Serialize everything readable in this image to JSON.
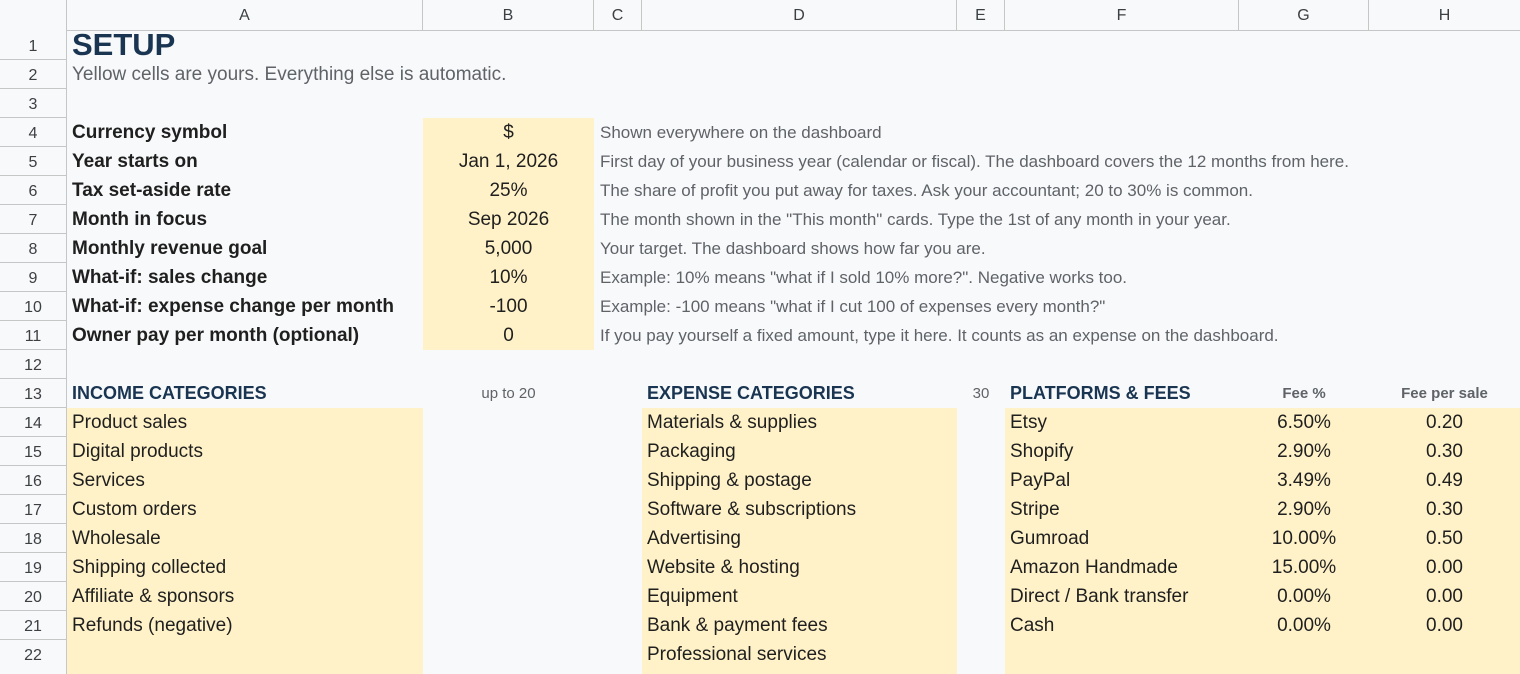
{
  "columns": [
    "A",
    "B",
    "C",
    "D",
    "E",
    "F",
    "G",
    "H"
  ],
  "rows": [
    "1",
    "2",
    "3",
    "4",
    "5",
    "6",
    "7",
    "8",
    "9",
    "10",
    "11",
    "12",
    "13",
    "14",
    "15",
    "16",
    "17",
    "18",
    "19",
    "20",
    "21",
    "22"
  ],
  "title": "SETUP",
  "subtitle": "Yellow cells are yours. Everything else is automatic.",
  "settings": [
    {
      "label": "Currency symbol",
      "value": "$",
      "desc": "Shown everywhere on the dashboard"
    },
    {
      "label": "Year starts on",
      "value": "Jan 1, 2026",
      "desc": "First day of your business year (calendar or fiscal). The dashboard covers the 12 months from here."
    },
    {
      "label": "Tax set-aside rate",
      "value": "25%",
      "desc": "The share of profit you put away for taxes. Ask your accountant; 20 to 30% is common."
    },
    {
      "label": "Month in focus",
      "value": "Sep 2026",
      "desc": "The month shown in the \"This month\" cards. Type the 1st of any month in your year."
    },
    {
      "label": "Monthly revenue goal",
      "value": "5,000",
      "desc": "Your target. The dashboard shows how far you are."
    },
    {
      "label": "What-if: sales change",
      "value": "10%",
      "desc": "Example: 10% means \"what if I sold 10% more?\". Negative works too."
    },
    {
      "label": "What-if: expense change per month",
      "value": "-100",
      "desc": "Example: -100 means \"what if I cut 100 of expenses every month?\""
    },
    {
      "label": "Owner pay per month (optional)",
      "value": "0",
      "desc": "If you pay yourself a fixed amount, type it here. It counts as an expense on the dashboard."
    }
  ],
  "income": {
    "heading": "INCOME CATEGORIES",
    "note": "up to 20",
    "items": [
      "Product sales",
      "Digital products",
      "Services",
      "Custom orders",
      "Wholesale",
      "Shipping collected",
      "Affiliate & sponsors",
      "Refunds (negative)",
      ""
    ]
  },
  "expense": {
    "heading": "EXPENSE CATEGORIES",
    "note": "30",
    "items": [
      "Materials & supplies",
      "Packaging",
      "Shipping & postage",
      "Software & subscriptions",
      "Advertising",
      "Website & hosting",
      "Equipment",
      "Bank & payment fees",
      "Professional services"
    ]
  },
  "platforms": {
    "heading": "PLATFORMS & FEES",
    "fee_pct_header": "Fee %",
    "fee_sale_header": "Fee per sale",
    "items": [
      {
        "name": "Etsy",
        "pct": "6.50%",
        "sale": "0.20"
      },
      {
        "name": "Shopify",
        "pct": "2.90%",
        "sale": "0.30"
      },
      {
        "name": "PayPal",
        "pct": "3.49%",
        "sale": "0.49"
      },
      {
        "name": "Stripe",
        "pct": "2.90%",
        "sale": "0.30"
      },
      {
        "name": "Gumroad",
        "pct": "10.00%",
        "sale": "0.50"
      },
      {
        "name": "Amazon Handmade",
        "pct": "15.00%",
        "sale": "0.00"
      },
      {
        "name": "Direct / Bank transfer",
        "pct": "0.00%",
        "sale": "0.00"
      },
      {
        "name": "Cash",
        "pct": "0.00%",
        "sale": "0.00"
      },
      {
        "name": "",
        "pct": "",
        "sale": ""
      }
    ]
  },
  "colors": {
    "input_fill": "#fff2c8",
    "heading": "#1a3552",
    "muted": "#5f6368"
  }
}
